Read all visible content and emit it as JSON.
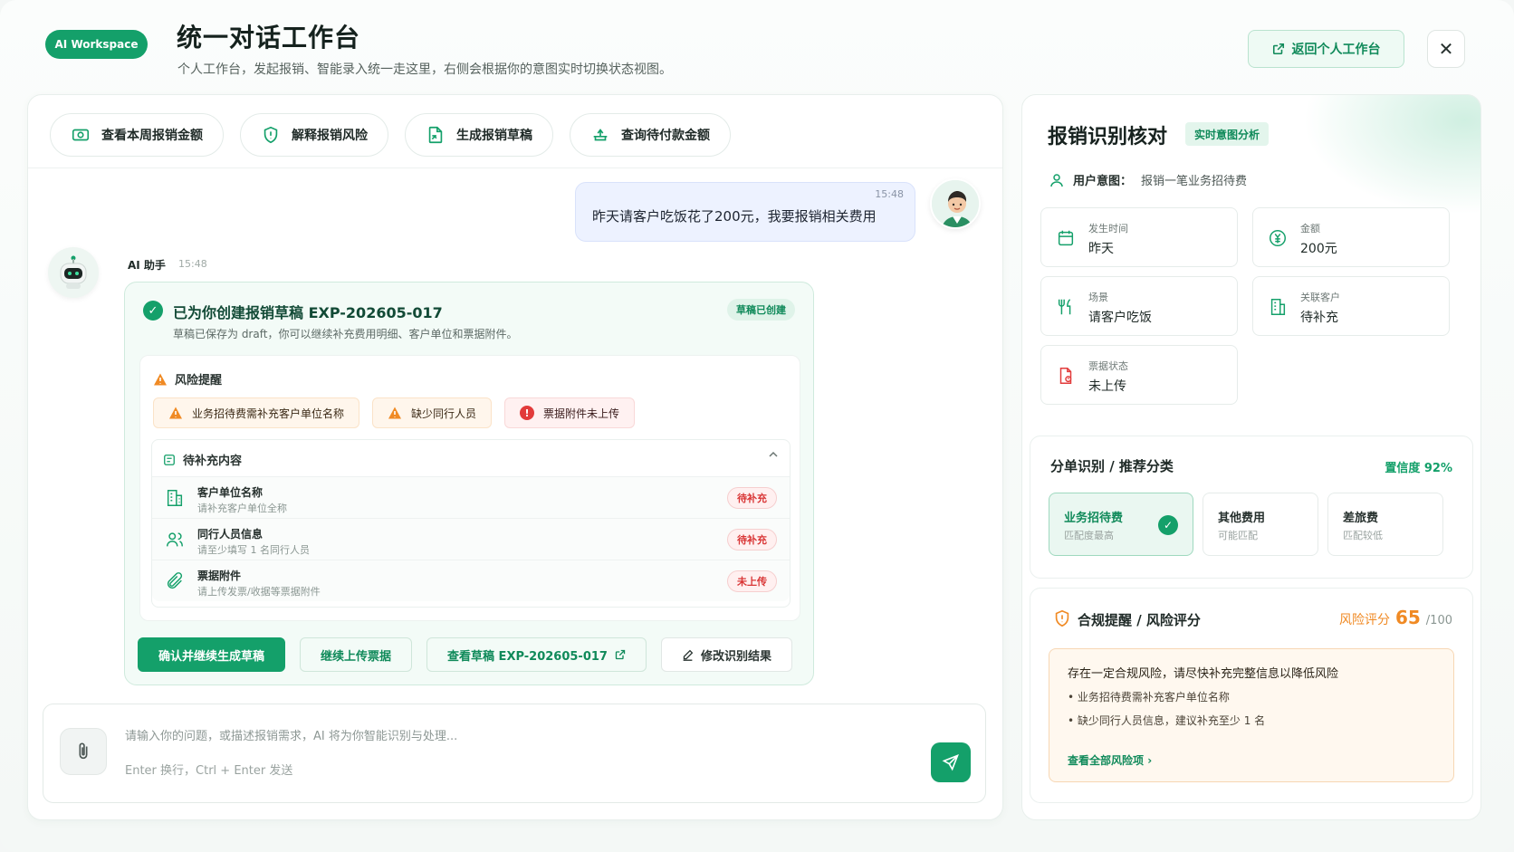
{
  "header": {
    "brand": "AI Workspace",
    "title": "统一对话工作台",
    "subtitle": "个人工作台，发起报销、智能录入统一走这里，右侧会根据你的意图实时切换状态视图。",
    "back_label": "返回个人工作台",
    "close_glyph": "✕"
  },
  "quick_actions": [
    {
      "label": "查看本周报销金额",
      "icon": "money-icon"
    },
    {
      "label": "解释报销风险",
      "icon": "shield-icon"
    },
    {
      "label": "生成报销草稿",
      "icon": "document-edit-icon"
    },
    {
      "label": "查询待付款金额",
      "icon": "payment-icon"
    }
  ],
  "chat": {
    "user_message": {
      "time": "15:48",
      "text": "昨天请客户吃饭花了200元，我要报销相关费用"
    },
    "bot": {
      "name": "AI 助手",
      "time": "15:48"
    },
    "draft": {
      "title": "已为你创建报销草稿 EXP-202605-017",
      "badge": "草稿已创建",
      "desc": "草稿已保存为 draft，你可以继续补充费用明细、客户单位和票据附件。",
      "risk_title": "风险提醒",
      "risk_tags": [
        {
          "label": "业务招待费需补充客户单位名称",
          "level": "warning"
        },
        {
          "label": "缺少同行人员",
          "level": "warning"
        },
        {
          "label": "票据附件未上传",
          "level": "error"
        }
      ],
      "pending_title": "待补充内容",
      "pending_items": [
        {
          "title": "客户单位名称",
          "hint": "请补充客户单位全称",
          "status": "待补充",
          "icon": "building-icon"
        },
        {
          "title": "同行人员信息",
          "hint": "请至少填写 1 名同行人员",
          "status": "待补充",
          "icon": "users-icon"
        },
        {
          "title": "票据附件",
          "hint": "请上传发票/收据等票据附件",
          "status": "未上传",
          "icon": "paperclip-icon"
        }
      ],
      "actions": {
        "confirm": "确认并继续生成草稿",
        "upload": "继续上传票据",
        "view": "查看草稿 EXP-202605-017",
        "edit": "修改识别结果"
      }
    }
  },
  "composer": {
    "placeholder": "请输入你的问题，或描述报销需求，AI 将为你智能识别与处理...",
    "hint": "Enter 换行，Ctrl + Enter 发送"
  },
  "side": {
    "title": "报销识别核对",
    "tag": "实时意图分析",
    "intent_label": "用户意图：",
    "intent_value": "报销一笔业务招待费",
    "fields": [
      {
        "label": "发生时间",
        "value": "昨天",
        "icon": "calendar-icon"
      },
      {
        "label": "金额",
        "value": "200元",
        "icon": "yen-icon"
      },
      {
        "label": "场景",
        "value": "请客户吃饭",
        "icon": "dining-icon"
      },
      {
        "label": "关联客户",
        "value": "待补充",
        "icon": "building-icon"
      },
      {
        "label": "票据状态",
        "value": "未上传",
        "icon": "receipt-icon"
      }
    ],
    "classification": {
      "title": "分单识别 / 推荐分类",
      "confidence": "置信度 92%",
      "options": [
        {
          "name": "业务招待费",
          "sub": "匹配度最高",
          "selected": true
        },
        {
          "name": "其他费用",
          "sub": "可能匹配",
          "selected": false
        },
        {
          "name": "差旅费",
          "sub": "匹配较低",
          "selected": false
        }
      ]
    },
    "compliance": {
      "title": "合规提醒 / 风险评分",
      "score_label": "风险评分",
      "score": "65",
      "score_max": "/100",
      "summary": "存在一定合规风险，请尽快补充完整信息以降低风险",
      "items": [
        "业务招待费需补充客户单位名称",
        "缺少同行人员信息，建议补充至少 1 名"
      ],
      "more": "查看全部风险项"
    }
  },
  "colors": {
    "brand": "#14a06a",
    "warning": "#f08a24",
    "danger": "#e23b3b"
  }
}
